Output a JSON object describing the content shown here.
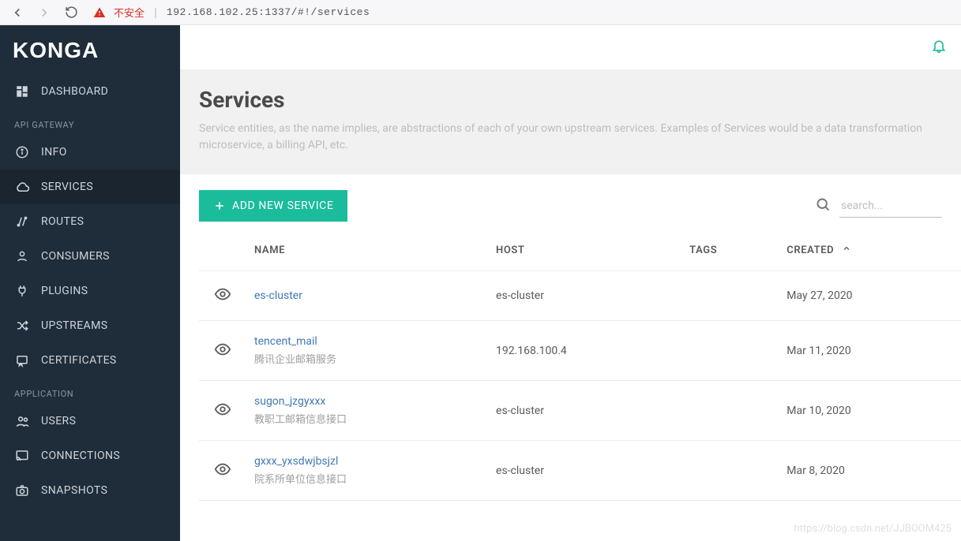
{
  "browser": {
    "insecure_label": "不安全",
    "url": "192.168.102.25:1337/#!/services"
  },
  "logo": "KONGA",
  "sidebar": {
    "dashboard": "DASHBOARD",
    "section_api": "API GATEWAY",
    "info": "INFO",
    "services": "SERVICES",
    "routes": "ROUTES",
    "consumers": "CONSUMERS",
    "plugins": "PLUGINS",
    "upstreams": "UPSTREAMS",
    "certificates": "CERTIFICATES",
    "section_application": "APPLICATION",
    "users": "USERS",
    "connections": "CONNECTIONS",
    "snapshots": "SNAPSHOTS"
  },
  "page": {
    "title": "Services",
    "description": "Service entities, as the name implies, are abstractions of each of your own upstream services. Examples of Services would be a data transformation microservice, a billing API, etc.",
    "add_button": "ADD NEW SERVICE",
    "search_placeholder": "search..."
  },
  "table": {
    "headers": {
      "name": "NAME",
      "host": "HOST",
      "tags": "TAGS",
      "created": "CREATED"
    },
    "rows": [
      {
        "name": "es-cluster",
        "subtitle": "",
        "host": "es-cluster",
        "tags": "",
        "created": "May 27, 2020"
      },
      {
        "name": "tencent_mail",
        "subtitle": "腾讯企业邮箱服务",
        "host": "192.168.100.4",
        "tags": "",
        "created": "Mar 11, 2020"
      },
      {
        "name": "sugon_jzgyxxx",
        "subtitle": "教职工邮箱信息接口",
        "host": "es-cluster",
        "tags": "",
        "created": "Mar 10, 2020"
      },
      {
        "name": "gxxx_yxsdwjbsjzl",
        "subtitle": "院系所单位信息接口",
        "host": "es-cluster",
        "tags": "",
        "created": "Mar 8, 2020"
      }
    ]
  },
  "watermark": "https://blog.csdn.net/JJBOOM425"
}
